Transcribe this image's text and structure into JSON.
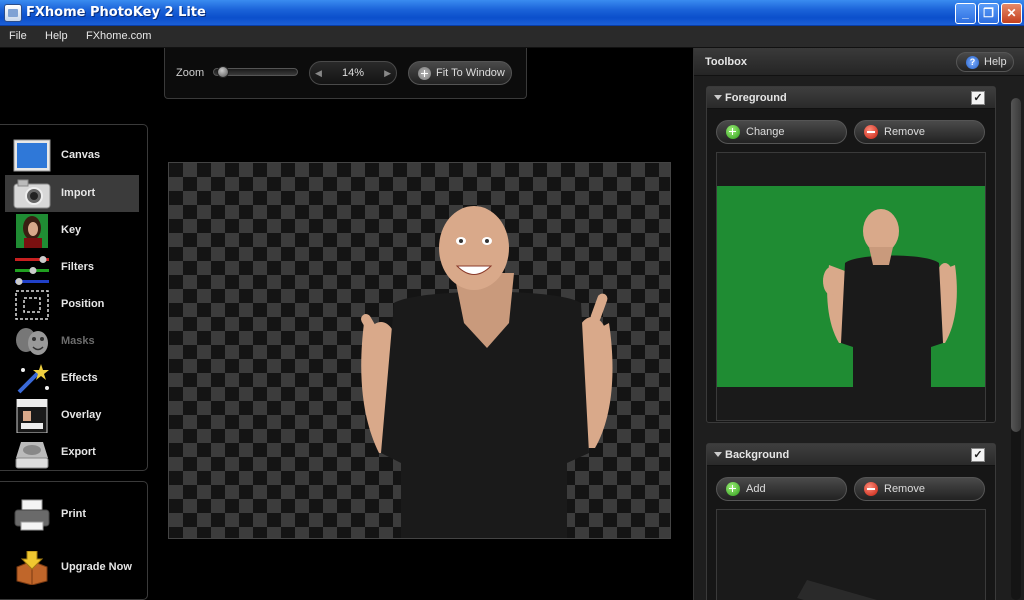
{
  "window": {
    "title": "FXhome PhotoKey 2 Lite"
  },
  "menu": {
    "file": "File",
    "help": "Help",
    "site": "FXhome.com"
  },
  "zoom": {
    "label": "Zoom",
    "value": "14%",
    "fit_label": "Fit To Window",
    "slider_fraction": 0.05
  },
  "nav": {
    "items": [
      {
        "label": "Canvas",
        "icon": "canvas-icon",
        "active": false,
        "enabled": true
      },
      {
        "label": "Import",
        "icon": "camera-icon",
        "active": true,
        "enabled": true
      },
      {
        "label": "Key",
        "icon": "key-portrait-icon",
        "active": false,
        "enabled": true
      },
      {
        "label": "Filters",
        "icon": "sliders-icon",
        "active": false,
        "enabled": true
      },
      {
        "label": "Position",
        "icon": "position-marquee-icon",
        "active": false,
        "enabled": true
      },
      {
        "label": "Masks",
        "icon": "theatre-masks-icon",
        "active": false,
        "enabled": false
      },
      {
        "label": "Effects",
        "icon": "magic-wand-icon",
        "active": false,
        "enabled": true
      },
      {
        "label": "Overlay",
        "icon": "overlay-magazine-icon",
        "active": false,
        "enabled": true
      },
      {
        "label": "Export",
        "icon": "export-disk-icon",
        "active": false,
        "enabled": true
      }
    ],
    "bottom": [
      {
        "label": "Print",
        "icon": "printer-icon"
      },
      {
        "label": "Upgrade Now",
        "icon": "upgrade-box-icon"
      }
    ]
  },
  "toolbox": {
    "title": "Toolbox",
    "help_label": "Help",
    "help_glyph": "?",
    "foreground": {
      "title": "Foreground",
      "checked": true,
      "check_glyph": "✓",
      "change_label": "Change",
      "remove_label": "Remove"
    },
    "background": {
      "title": "Background",
      "checked": true,
      "check_glyph": "✓",
      "add_label": "Add",
      "remove_label": "Remove"
    }
  },
  "colors": {
    "green_screen": "#1f8c33",
    "shirt": "#1a1a1a",
    "skin": "#d9a98a",
    "titlebar": "#0b4fcc"
  }
}
